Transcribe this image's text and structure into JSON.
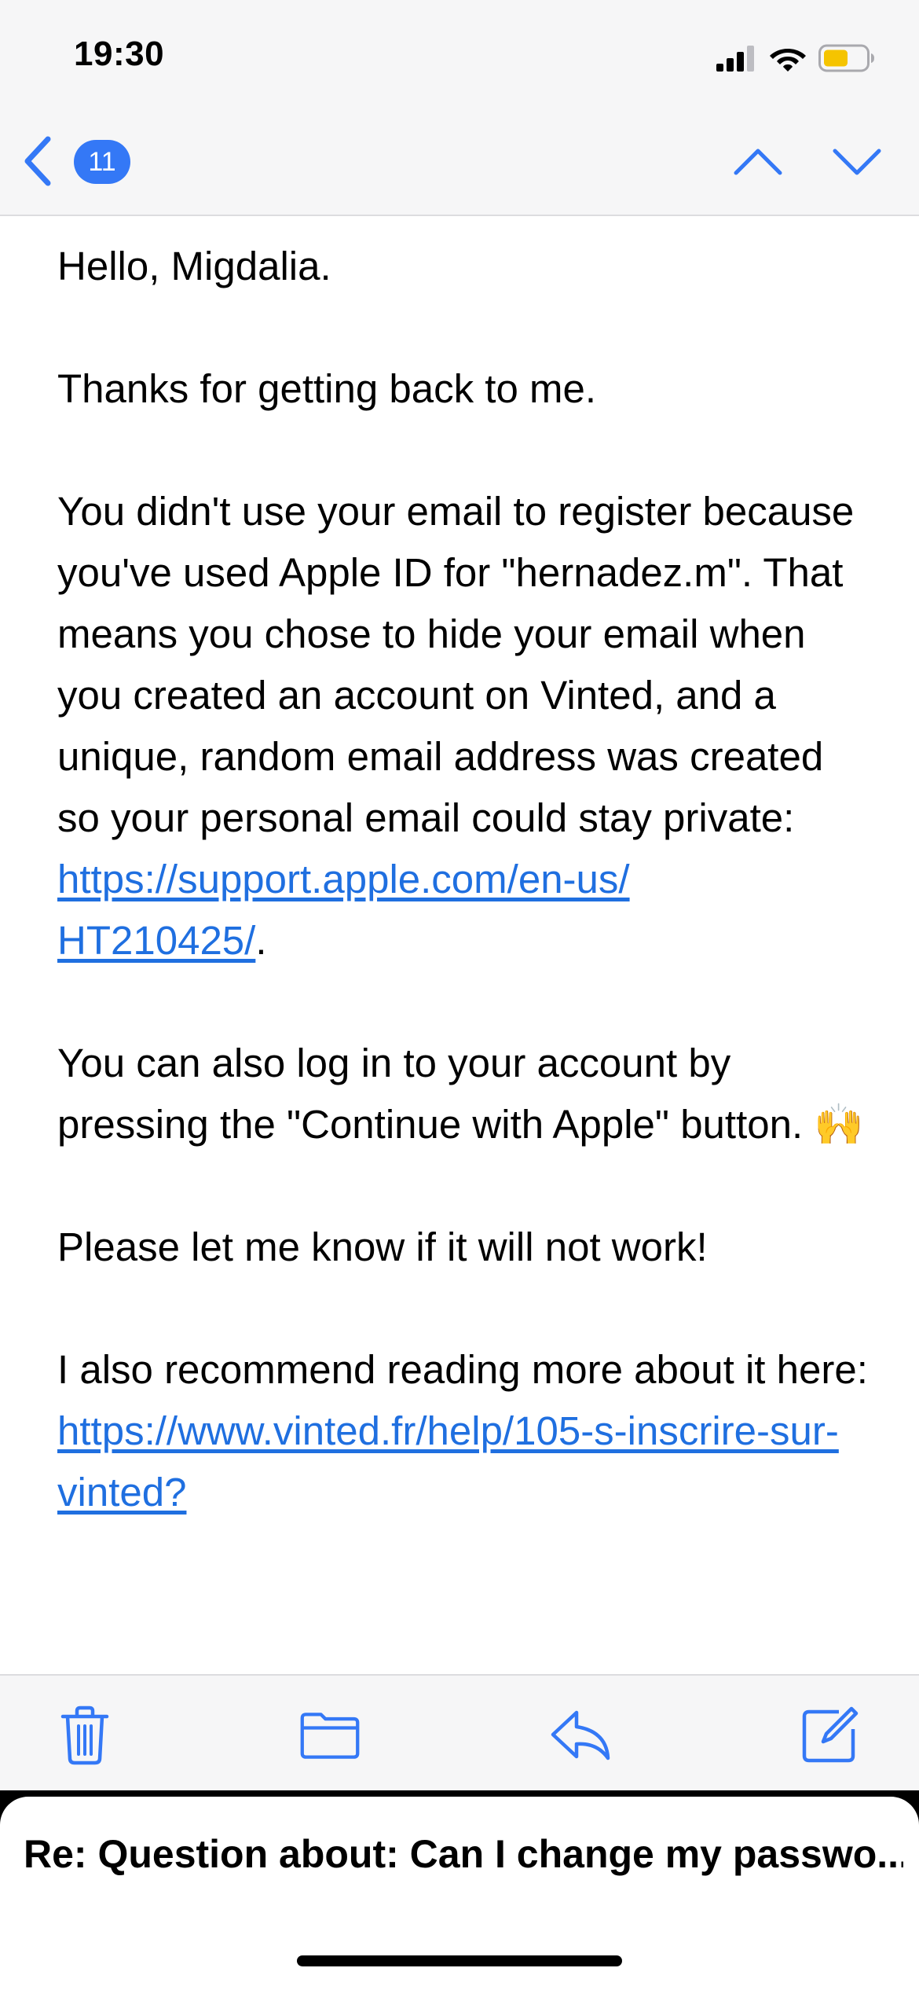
{
  "status_bar": {
    "time": "19:30"
  },
  "nav": {
    "message_count": "11"
  },
  "message": {
    "greeting": "Hello, Migdalia.",
    "thanks": "Thanks for getting back to me.",
    "explanation": "You didn't use your email to register because you've used Apple ID for \"hernadez.m\". That means you chose to hide your email when you created an account on Vinted, and a unique, random email address was created so your personal email could stay private:",
    "apple_link_line1": "https://support.apple.com/en-us/",
    "apple_link_line2": "HT210425/",
    "apple_link_suffix": ".",
    "login_tip": "You can also log in to your account by pressing the \"Continue with Apple\" button. 🙌",
    "let_me_know": "Please let me know if it will not work!",
    "recommend_prefix": "I also recommend reading more about it here: ",
    "vinted_link": "https://www.vinted.fr/help/105-s-inscrire-sur-vinted?"
  },
  "thread": {
    "subject": "Re: Question about: Can I change my passwo..."
  },
  "colors": {
    "accent": "#3478f6",
    "link": "#1f6fe0",
    "battery": "#f5c400"
  },
  "icons": {
    "back": "chevron-left-icon",
    "previous": "chevron-up-icon",
    "next": "chevron-down-icon",
    "trash": "trash-icon",
    "folder": "folder-icon",
    "reply": "reply-icon",
    "compose": "compose-icon"
  }
}
